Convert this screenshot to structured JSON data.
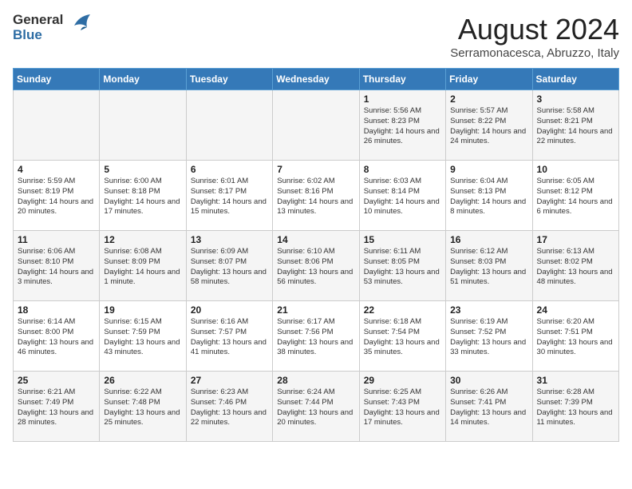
{
  "header": {
    "logo": {
      "general": "General",
      "blue": "Blue"
    },
    "title": "August 2024",
    "subtitle": "Serramonacesca, Abruzzo, Italy"
  },
  "days_of_week": [
    "Sunday",
    "Monday",
    "Tuesday",
    "Wednesday",
    "Thursday",
    "Friday",
    "Saturday"
  ],
  "weeks": [
    [
      {
        "day": "",
        "info": ""
      },
      {
        "day": "",
        "info": ""
      },
      {
        "day": "",
        "info": ""
      },
      {
        "day": "",
        "info": ""
      },
      {
        "day": "1",
        "info": "Sunrise: 5:56 AM\nSunset: 8:23 PM\nDaylight: 14 hours and 26 minutes."
      },
      {
        "day": "2",
        "info": "Sunrise: 5:57 AM\nSunset: 8:22 PM\nDaylight: 14 hours and 24 minutes."
      },
      {
        "day": "3",
        "info": "Sunrise: 5:58 AM\nSunset: 8:21 PM\nDaylight: 14 hours and 22 minutes."
      }
    ],
    [
      {
        "day": "4",
        "info": "Sunrise: 5:59 AM\nSunset: 8:19 PM\nDaylight: 14 hours and 20 minutes."
      },
      {
        "day": "5",
        "info": "Sunrise: 6:00 AM\nSunset: 8:18 PM\nDaylight: 14 hours and 17 minutes."
      },
      {
        "day": "6",
        "info": "Sunrise: 6:01 AM\nSunset: 8:17 PM\nDaylight: 14 hours and 15 minutes."
      },
      {
        "day": "7",
        "info": "Sunrise: 6:02 AM\nSunset: 8:16 PM\nDaylight: 14 hours and 13 minutes."
      },
      {
        "day": "8",
        "info": "Sunrise: 6:03 AM\nSunset: 8:14 PM\nDaylight: 14 hours and 10 minutes."
      },
      {
        "day": "9",
        "info": "Sunrise: 6:04 AM\nSunset: 8:13 PM\nDaylight: 14 hours and 8 minutes."
      },
      {
        "day": "10",
        "info": "Sunrise: 6:05 AM\nSunset: 8:12 PM\nDaylight: 14 hours and 6 minutes."
      }
    ],
    [
      {
        "day": "11",
        "info": "Sunrise: 6:06 AM\nSunset: 8:10 PM\nDaylight: 14 hours and 3 minutes."
      },
      {
        "day": "12",
        "info": "Sunrise: 6:08 AM\nSunset: 8:09 PM\nDaylight: 14 hours and 1 minute."
      },
      {
        "day": "13",
        "info": "Sunrise: 6:09 AM\nSunset: 8:07 PM\nDaylight: 13 hours and 58 minutes."
      },
      {
        "day": "14",
        "info": "Sunrise: 6:10 AM\nSunset: 8:06 PM\nDaylight: 13 hours and 56 minutes."
      },
      {
        "day": "15",
        "info": "Sunrise: 6:11 AM\nSunset: 8:05 PM\nDaylight: 13 hours and 53 minutes."
      },
      {
        "day": "16",
        "info": "Sunrise: 6:12 AM\nSunset: 8:03 PM\nDaylight: 13 hours and 51 minutes."
      },
      {
        "day": "17",
        "info": "Sunrise: 6:13 AM\nSunset: 8:02 PM\nDaylight: 13 hours and 48 minutes."
      }
    ],
    [
      {
        "day": "18",
        "info": "Sunrise: 6:14 AM\nSunset: 8:00 PM\nDaylight: 13 hours and 46 minutes."
      },
      {
        "day": "19",
        "info": "Sunrise: 6:15 AM\nSunset: 7:59 PM\nDaylight: 13 hours and 43 minutes."
      },
      {
        "day": "20",
        "info": "Sunrise: 6:16 AM\nSunset: 7:57 PM\nDaylight: 13 hours and 41 minutes."
      },
      {
        "day": "21",
        "info": "Sunrise: 6:17 AM\nSunset: 7:56 PM\nDaylight: 13 hours and 38 minutes."
      },
      {
        "day": "22",
        "info": "Sunrise: 6:18 AM\nSunset: 7:54 PM\nDaylight: 13 hours and 35 minutes."
      },
      {
        "day": "23",
        "info": "Sunrise: 6:19 AM\nSunset: 7:52 PM\nDaylight: 13 hours and 33 minutes."
      },
      {
        "day": "24",
        "info": "Sunrise: 6:20 AM\nSunset: 7:51 PM\nDaylight: 13 hours and 30 minutes."
      }
    ],
    [
      {
        "day": "25",
        "info": "Sunrise: 6:21 AM\nSunset: 7:49 PM\nDaylight: 13 hours and 28 minutes."
      },
      {
        "day": "26",
        "info": "Sunrise: 6:22 AM\nSunset: 7:48 PM\nDaylight: 13 hours and 25 minutes."
      },
      {
        "day": "27",
        "info": "Sunrise: 6:23 AM\nSunset: 7:46 PM\nDaylight: 13 hours and 22 minutes."
      },
      {
        "day": "28",
        "info": "Sunrise: 6:24 AM\nSunset: 7:44 PM\nDaylight: 13 hours and 20 minutes."
      },
      {
        "day": "29",
        "info": "Sunrise: 6:25 AM\nSunset: 7:43 PM\nDaylight: 13 hours and 17 minutes."
      },
      {
        "day": "30",
        "info": "Sunrise: 6:26 AM\nSunset: 7:41 PM\nDaylight: 13 hours and 14 minutes."
      },
      {
        "day": "31",
        "info": "Sunrise: 6:28 AM\nSunset: 7:39 PM\nDaylight: 13 hours and 11 minutes."
      }
    ]
  ]
}
